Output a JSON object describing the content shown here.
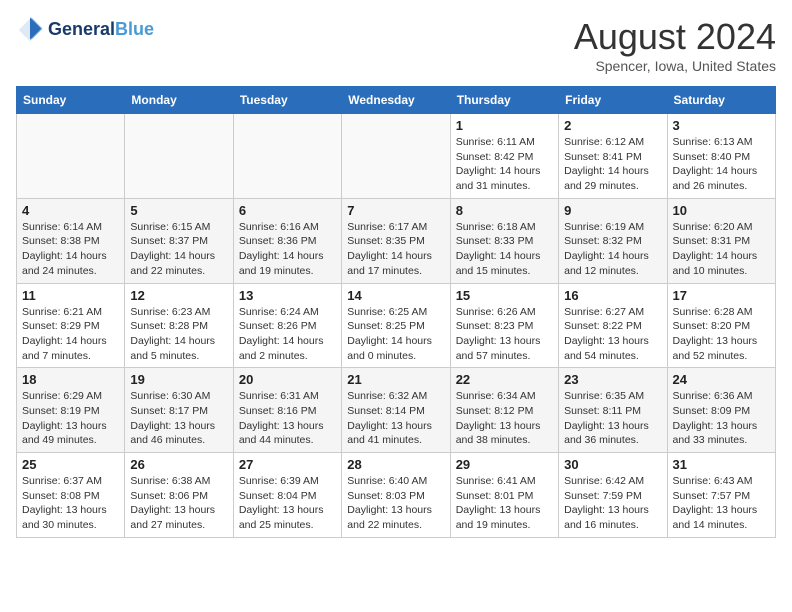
{
  "header": {
    "logo_line1": "General",
    "logo_line2": "Blue",
    "month_title": "August 2024",
    "location": "Spencer, Iowa, United States"
  },
  "weekdays": [
    "Sunday",
    "Monday",
    "Tuesday",
    "Wednesday",
    "Thursday",
    "Friday",
    "Saturday"
  ],
  "weeks": [
    [
      {
        "day": "",
        "info": ""
      },
      {
        "day": "",
        "info": ""
      },
      {
        "day": "",
        "info": ""
      },
      {
        "day": "",
        "info": ""
      },
      {
        "day": "1",
        "info": "Sunrise: 6:11 AM\nSunset: 8:42 PM\nDaylight: 14 hours\nand 31 minutes."
      },
      {
        "day": "2",
        "info": "Sunrise: 6:12 AM\nSunset: 8:41 PM\nDaylight: 14 hours\nand 29 minutes."
      },
      {
        "day": "3",
        "info": "Sunrise: 6:13 AM\nSunset: 8:40 PM\nDaylight: 14 hours\nand 26 minutes."
      }
    ],
    [
      {
        "day": "4",
        "info": "Sunrise: 6:14 AM\nSunset: 8:38 PM\nDaylight: 14 hours\nand 24 minutes."
      },
      {
        "day": "5",
        "info": "Sunrise: 6:15 AM\nSunset: 8:37 PM\nDaylight: 14 hours\nand 22 minutes."
      },
      {
        "day": "6",
        "info": "Sunrise: 6:16 AM\nSunset: 8:36 PM\nDaylight: 14 hours\nand 19 minutes."
      },
      {
        "day": "7",
        "info": "Sunrise: 6:17 AM\nSunset: 8:35 PM\nDaylight: 14 hours\nand 17 minutes."
      },
      {
        "day": "8",
        "info": "Sunrise: 6:18 AM\nSunset: 8:33 PM\nDaylight: 14 hours\nand 15 minutes."
      },
      {
        "day": "9",
        "info": "Sunrise: 6:19 AM\nSunset: 8:32 PM\nDaylight: 14 hours\nand 12 minutes."
      },
      {
        "day": "10",
        "info": "Sunrise: 6:20 AM\nSunset: 8:31 PM\nDaylight: 14 hours\nand 10 minutes."
      }
    ],
    [
      {
        "day": "11",
        "info": "Sunrise: 6:21 AM\nSunset: 8:29 PM\nDaylight: 14 hours\nand 7 minutes."
      },
      {
        "day": "12",
        "info": "Sunrise: 6:23 AM\nSunset: 8:28 PM\nDaylight: 14 hours\nand 5 minutes."
      },
      {
        "day": "13",
        "info": "Sunrise: 6:24 AM\nSunset: 8:26 PM\nDaylight: 14 hours\nand 2 minutes."
      },
      {
        "day": "14",
        "info": "Sunrise: 6:25 AM\nSunset: 8:25 PM\nDaylight: 14 hours\nand 0 minutes."
      },
      {
        "day": "15",
        "info": "Sunrise: 6:26 AM\nSunset: 8:23 PM\nDaylight: 13 hours\nand 57 minutes."
      },
      {
        "day": "16",
        "info": "Sunrise: 6:27 AM\nSunset: 8:22 PM\nDaylight: 13 hours\nand 54 minutes."
      },
      {
        "day": "17",
        "info": "Sunrise: 6:28 AM\nSunset: 8:20 PM\nDaylight: 13 hours\nand 52 minutes."
      }
    ],
    [
      {
        "day": "18",
        "info": "Sunrise: 6:29 AM\nSunset: 8:19 PM\nDaylight: 13 hours\nand 49 minutes."
      },
      {
        "day": "19",
        "info": "Sunrise: 6:30 AM\nSunset: 8:17 PM\nDaylight: 13 hours\nand 46 minutes."
      },
      {
        "day": "20",
        "info": "Sunrise: 6:31 AM\nSunset: 8:16 PM\nDaylight: 13 hours\nand 44 minutes."
      },
      {
        "day": "21",
        "info": "Sunrise: 6:32 AM\nSunset: 8:14 PM\nDaylight: 13 hours\nand 41 minutes."
      },
      {
        "day": "22",
        "info": "Sunrise: 6:34 AM\nSunset: 8:12 PM\nDaylight: 13 hours\nand 38 minutes."
      },
      {
        "day": "23",
        "info": "Sunrise: 6:35 AM\nSunset: 8:11 PM\nDaylight: 13 hours\nand 36 minutes."
      },
      {
        "day": "24",
        "info": "Sunrise: 6:36 AM\nSunset: 8:09 PM\nDaylight: 13 hours\nand 33 minutes."
      }
    ],
    [
      {
        "day": "25",
        "info": "Sunrise: 6:37 AM\nSunset: 8:08 PM\nDaylight: 13 hours\nand 30 minutes."
      },
      {
        "day": "26",
        "info": "Sunrise: 6:38 AM\nSunset: 8:06 PM\nDaylight: 13 hours\nand 27 minutes."
      },
      {
        "day": "27",
        "info": "Sunrise: 6:39 AM\nSunset: 8:04 PM\nDaylight: 13 hours\nand 25 minutes."
      },
      {
        "day": "28",
        "info": "Sunrise: 6:40 AM\nSunset: 8:03 PM\nDaylight: 13 hours\nand 22 minutes."
      },
      {
        "day": "29",
        "info": "Sunrise: 6:41 AM\nSunset: 8:01 PM\nDaylight: 13 hours\nand 19 minutes."
      },
      {
        "day": "30",
        "info": "Sunrise: 6:42 AM\nSunset: 7:59 PM\nDaylight: 13 hours\nand 16 minutes."
      },
      {
        "day": "31",
        "info": "Sunrise: 6:43 AM\nSunset: 7:57 PM\nDaylight: 13 hours\nand 14 minutes."
      }
    ]
  ]
}
